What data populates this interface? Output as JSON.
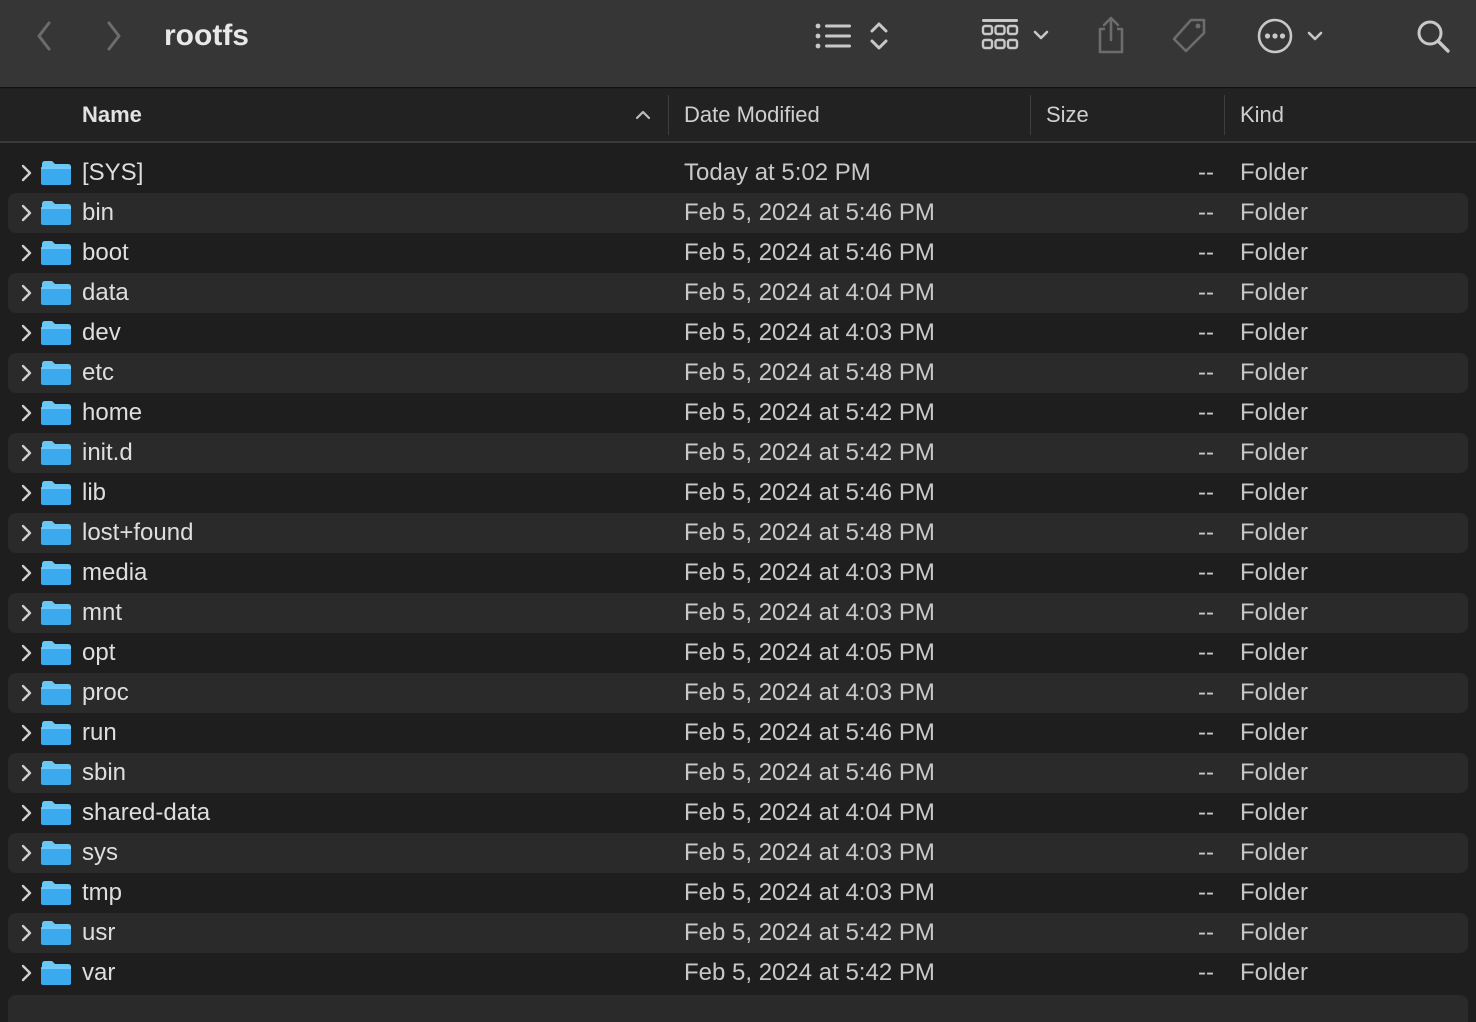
{
  "window": {
    "title": "rootfs"
  },
  "toolbar": {
    "back_icon": "chevron-left-icon",
    "forward_icon": "chevron-right-icon",
    "list_view_icon": "list-icon",
    "sort_icon": "up-down-chevrons-icon",
    "group_icon": "grid-icon",
    "share_icon": "share-icon",
    "tag_icon": "tag-icon",
    "more_icon": "ellipsis-circle-icon",
    "search_icon": "search-icon"
  },
  "columns": {
    "name": "Name",
    "date": "Date Modified",
    "size": "Size",
    "kind": "Kind",
    "sort_indicator": "ascending"
  },
  "files": [
    {
      "name": "[SYS]",
      "date": "Today at 5:02 PM",
      "size": "--",
      "kind": "Folder"
    },
    {
      "name": "bin",
      "date": "Feb 5, 2024 at 5:46 PM",
      "size": "--",
      "kind": "Folder"
    },
    {
      "name": "boot",
      "date": "Feb 5, 2024 at 5:46 PM",
      "size": "--",
      "kind": "Folder"
    },
    {
      "name": "data",
      "date": "Feb 5, 2024 at 4:04 PM",
      "size": "--",
      "kind": "Folder"
    },
    {
      "name": "dev",
      "date": "Feb 5, 2024 at 4:03 PM",
      "size": "--",
      "kind": "Folder"
    },
    {
      "name": "etc",
      "date": "Feb 5, 2024 at 5:48 PM",
      "size": "--",
      "kind": "Folder"
    },
    {
      "name": "home",
      "date": "Feb 5, 2024 at 5:42 PM",
      "size": "--",
      "kind": "Folder"
    },
    {
      "name": "init.d",
      "date": "Feb 5, 2024 at 5:42 PM",
      "size": "--",
      "kind": "Folder"
    },
    {
      "name": "lib",
      "date": "Feb 5, 2024 at 5:46 PM",
      "size": "--",
      "kind": "Folder"
    },
    {
      "name": "lost+found",
      "date": "Feb 5, 2024 at 5:48 PM",
      "size": "--",
      "kind": "Folder"
    },
    {
      "name": "media",
      "date": "Feb 5, 2024 at 4:03 PM",
      "size": "--",
      "kind": "Folder"
    },
    {
      "name": "mnt",
      "date": "Feb 5, 2024 at 4:03 PM",
      "size": "--",
      "kind": "Folder"
    },
    {
      "name": "opt",
      "date": "Feb 5, 2024 at 4:05 PM",
      "size": "--",
      "kind": "Folder"
    },
    {
      "name": "proc",
      "date": "Feb 5, 2024 at 4:03 PM",
      "size": "--",
      "kind": "Folder"
    },
    {
      "name": "run",
      "date": "Feb 5, 2024 at 5:46 PM",
      "size": "--",
      "kind": "Folder"
    },
    {
      "name": "sbin",
      "date": "Feb 5, 2024 at 5:46 PM",
      "size": "--",
      "kind": "Folder"
    },
    {
      "name": "shared-data",
      "date": "Feb 5, 2024 at 4:04 PM",
      "size": "--",
      "kind": "Folder"
    },
    {
      "name": "sys",
      "date": "Feb 5, 2024 at 4:03 PM",
      "size": "--",
      "kind": "Folder"
    },
    {
      "name": "tmp",
      "date": "Feb 5, 2024 at 4:03 PM",
      "size": "--",
      "kind": "Folder"
    },
    {
      "name": "usr",
      "date": "Feb 5, 2024 at 5:42 PM",
      "size": "--",
      "kind": "Folder"
    },
    {
      "name": "var",
      "date": "Feb 5, 2024 at 5:42 PM",
      "size": "--",
      "kind": "Folder"
    }
  ],
  "colors": {
    "folder_top": "#6ac8f5",
    "folder_body": "#3aa9ee",
    "toolbar_bg": "#363636",
    "window_bg": "#1e1e1e",
    "row_alt": "#2a2a2a"
  }
}
